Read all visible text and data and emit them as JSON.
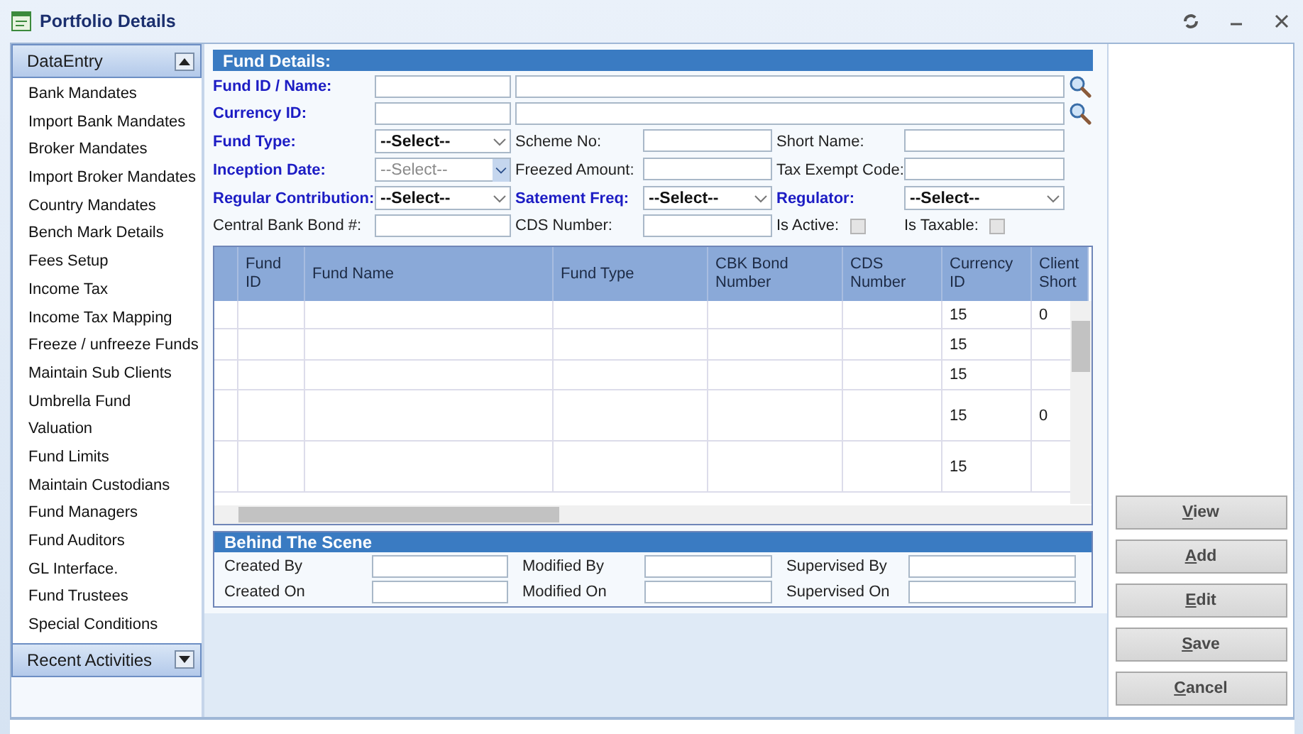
{
  "window": {
    "title": "Portfolio Details"
  },
  "sidebar": {
    "sections": [
      {
        "title": "DataEntry",
        "expanded": true,
        "items": [
          "Bank Mandates",
          "Import Bank Mandates",
          "Broker Mandates",
          "Import Broker Mandates",
          "Country Mandates",
          "Bench Mark Details",
          "Fees Setup",
          "Income Tax",
          "Income Tax Mapping",
          "Freeze / unfreeze Funds",
          "Maintain Sub Clients",
          "Umbrella Fund",
          "Valuation",
          "Fund Limits",
          "Maintain Custodians",
          "Fund Managers",
          "Fund Auditors",
          "GL Interface.",
          "Fund Trustees",
          "Special Conditions"
        ]
      },
      {
        "title": "Recent Activities",
        "expanded": false
      }
    ]
  },
  "fund_details": {
    "title": "Fund Details:",
    "lookup_rows": [
      {
        "label": "Fund ID / Name:",
        "required": true
      },
      {
        "label": "Currency ID:",
        "required": true
      }
    ],
    "rows": [
      [
        {
          "label": "Fund Type:",
          "required": true,
          "kind": "select",
          "value": "--Select--",
          "disabled": false
        },
        {
          "label": "Scheme No:",
          "required": false,
          "kind": "text"
        },
        {
          "label": "Short Name:",
          "required": false,
          "kind": "text"
        }
      ],
      [
        {
          "label": "Inception Date:",
          "required": true,
          "kind": "select",
          "value": "--Select--",
          "disabled": true
        },
        {
          "label": "Freezed Amount:",
          "required": false,
          "kind": "text"
        },
        {
          "label": "Tax Exempt Code:",
          "required": false,
          "kind": "text"
        }
      ],
      [
        {
          "label": "Regular Contribution:",
          "required": true,
          "kind": "select",
          "value": "--Select--",
          "disabled": false
        },
        {
          "label": "Satement Freq:",
          "required": true,
          "kind": "select",
          "value": "--Select--",
          "disabled": false
        },
        {
          "label": "Regulator:",
          "required": true,
          "kind": "select",
          "value": "--Select--",
          "disabled": false
        }
      ],
      [
        {
          "label": "Central Bank Bond #:",
          "required": false,
          "kind": "text"
        },
        {
          "label": "CDS Number:",
          "required": false,
          "kind": "text"
        },
        {
          "label": "Is Active:",
          "kind": "checkbox",
          "checked": false
        },
        {
          "label": "Is Taxable:",
          "kind": "checkbox",
          "checked": false
        }
      ]
    ]
  },
  "table": {
    "columns": [
      "Fund ID",
      "Fund Name",
      "Fund Type",
      "CBK Bond Number",
      "CDS Number",
      "Currency ID",
      "Client Short"
    ],
    "rows": [
      {
        "currency_id": "15",
        "client_short": "0"
      },
      {
        "currency_id": "15"
      },
      {
        "currency_id": "15"
      },
      {
        "currency_id": "15",
        "client_short": "0"
      },
      {
        "currency_id": "15"
      }
    ]
  },
  "behind_the_scene": {
    "title": "Behind The Scene",
    "fields": [
      [
        "Created By",
        "Modified By",
        "Supervised By"
      ],
      [
        "Created On",
        "Modified On",
        "Supervised On"
      ]
    ]
  },
  "buttons": [
    "View",
    "Add",
    "Edit",
    "Save",
    "Cancel"
  ]
}
